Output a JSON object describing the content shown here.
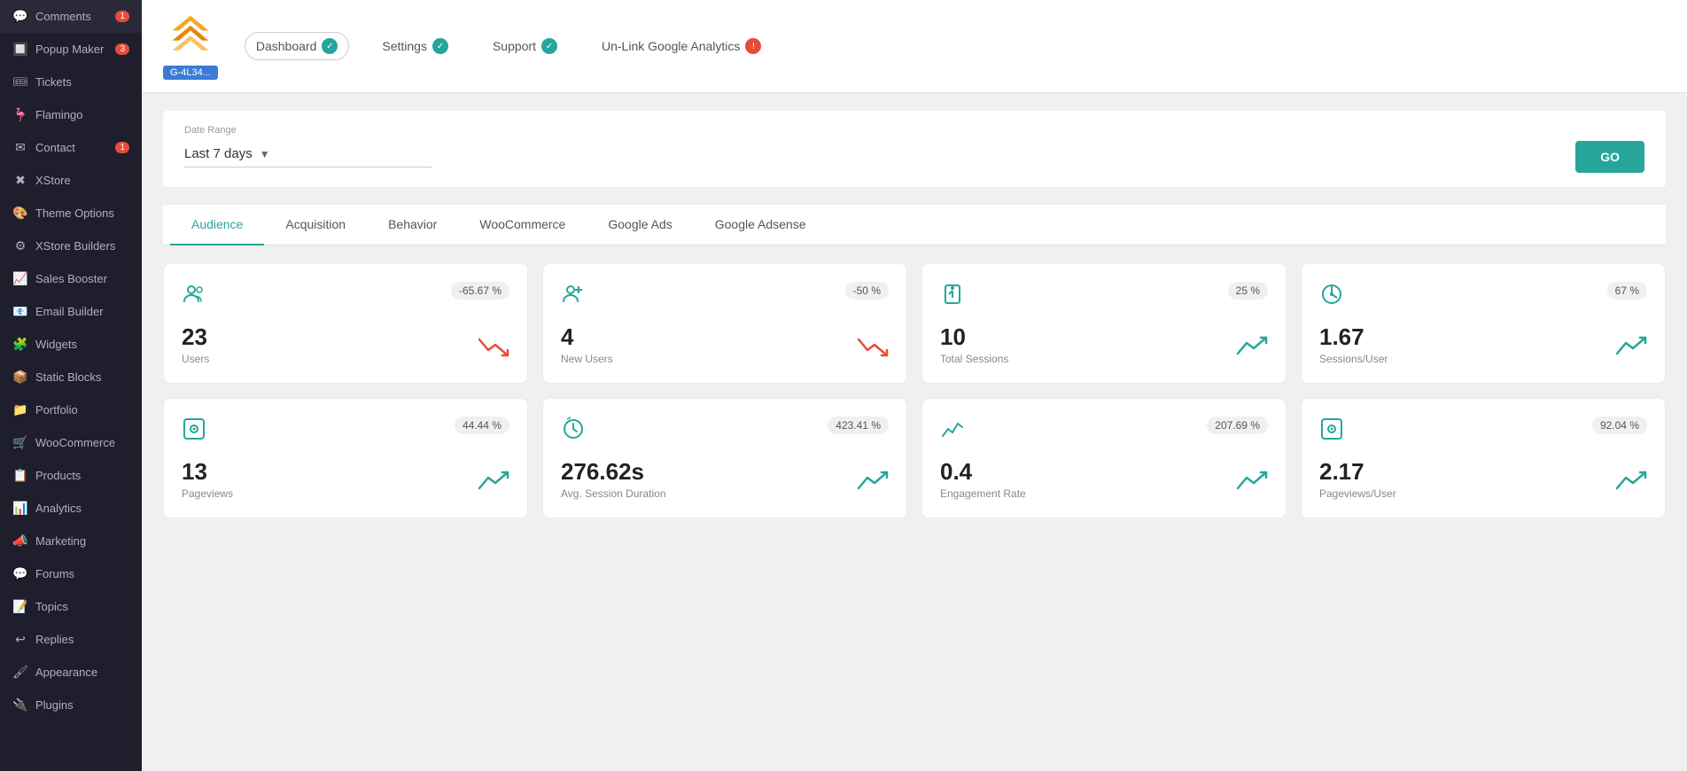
{
  "sidebar": {
    "items": [
      {
        "id": "comments",
        "label": "Comments",
        "icon": "💬",
        "badge": "1"
      },
      {
        "id": "popup-maker",
        "label": "Popup Maker",
        "icon": "🔲",
        "badge": "3"
      },
      {
        "id": "tickets",
        "label": "Tickets",
        "icon": "🎟",
        "badge": null
      },
      {
        "id": "flamingo",
        "label": "Flamingo",
        "icon": "🦩",
        "badge": null
      },
      {
        "id": "contact",
        "label": "Contact",
        "icon": "✉",
        "badge": "1"
      },
      {
        "id": "xstore",
        "label": "XStore",
        "icon": "✖",
        "badge": null
      },
      {
        "id": "theme-options",
        "label": "Theme Options",
        "icon": "🎨",
        "badge": null
      },
      {
        "id": "xstore-builders",
        "label": "XStore Builders",
        "icon": "⚙",
        "badge": null
      },
      {
        "id": "sales-booster",
        "label": "Sales Booster",
        "icon": "📈",
        "badge": null
      },
      {
        "id": "email-builder",
        "label": "Email Builder",
        "icon": "📧",
        "badge": null
      },
      {
        "id": "widgets",
        "label": "Widgets",
        "icon": "🧩",
        "badge": null
      },
      {
        "id": "static-blocks",
        "label": "Static Blocks",
        "icon": "📦",
        "badge": null
      },
      {
        "id": "portfolio",
        "label": "Portfolio",
        "icon": "📁",
        "badge": null
      },
      {
        "id": "woocommerce",
        "label": "WooCommerce",
        "icon": "🛒",
        "badge": null
      },
      {
        "id": "products",
        "label": "Products",
        "icon": "📋",
        "badge": null
      },
      {
        "id": "analytics",
        "label": "Analytics",
        "icon": "📊",
        "badge": null
      },
      {
        "id": "marketing",
        "label": "Marketing",
        "icon": "📣",
        "badge": null
      },
      {
        "id": "forums",
        "label": "Forums",
        "icon": "💬",
        "badge": null
      },
      {
        "id": "topics",
        "label": "Topics",
        "icon": "📝",
        "badge": null
      },
      {
        "id": "replies",
        "label": "Replies",
        "icon": "↩",
        "badge": null
      },
      {
        "id": "appearance",
        "label": "Appearance",
        "icon": "🖌",
        "badge": null
      },
      {
        "id": "plugins",
        "label": "Plugins",
        "icon": "🔌",
        "badge": null
      }
    ]
  },
  "header": {
    "logo_badge": "G-4L34...",
    "tabs": [
      {
        "id": "dashboard",
        "label": "Dashboard",
        "check_type": "green"
      },
      {
        "id": "settings",
        "label": "Settings",
        "check_type": "green"
      },
      {
        "id": "support",
        "label": "Support",
        "check_type": "green"
      },
      {
        "id": "unlink",
        "label": "Un-Link Google Analytics",
        "check_type": "red"
      }
    ]
  },
  "date_range": {
    "label": "Date Range",
    "value": "Last 7 days",
    "go_label": "GO"
  },
  "analytics_tabs": [
    {
      "id": "audience",
      "label": "Audience",
      "active": true
    },
    {
      "id": "acquisition",
      "label": "Acquisition",
      "active": false
    },
    {
      "id": "behavior",
      "label": "Behavior",
      "active": false
    },
    {
      "id": "woocommerce",
      "label": "WooCommerce",
      "active": false
    },
    {
      "id": "google-ads",
      "label": "Google Ads",
      "active": false
    },
    {
      "id": "google-adsense",
      "label": "Google Adsense",
      "active": false
    }
  ],
  "metrics_row1": [
    {
      "id": "users",
      "icon": "👥",
      "badge": "-65.67 %",
      "value": "23",
      "label": "Users",
      "trend": "down"
    },
    {
      "id": "new-users",
      "icon": "👤",
      "badge": "-50 %",
      "value": "4",
      "label": "New Users",
      "trend": "down"
    },
    {
      "id": "total-sessions",
      "icon": "⏳",
      "badge": "25 %",
      "value": "10",
      "label": "Total Sessions",
      "trend": "up"
    },
    {
      "id": "sessions-user",
      "icon": "🌗",
      "badge": "67 %",
      "value": "1.67",
      "label": "Sessions/User",
      "trend": "up"
    }
  ],
  "metrics_row2": [
    {
      "id": "pageviews",
      "icon": "🔍",
      "badge": "44.44 %",
      "value": "13",
      "label": "Pageviews",
      "trend": "up"
    },
    {
      "id": "avg-session-duration",
      "icon": "⏱",
      "badge": "423.41 %",
      "value": "276.62s",
      "label": "Avg. Session Duration",
      "trend": "up"
    },
    {
      "id": "engagement-rate",
      "icon": "📈",
      "badge": "207.69 %",
      "value": "0.4",
      "label": "Engagement Rate",
      "trend": "up"
    },
    {
      "id": "pageviews-user",
      "icon": "🔍",
      "badge": "92.04 %",
      "value": "2.17",
      "label": "Pageviews/User",
      "trend": "up"
    }
  ]
}
